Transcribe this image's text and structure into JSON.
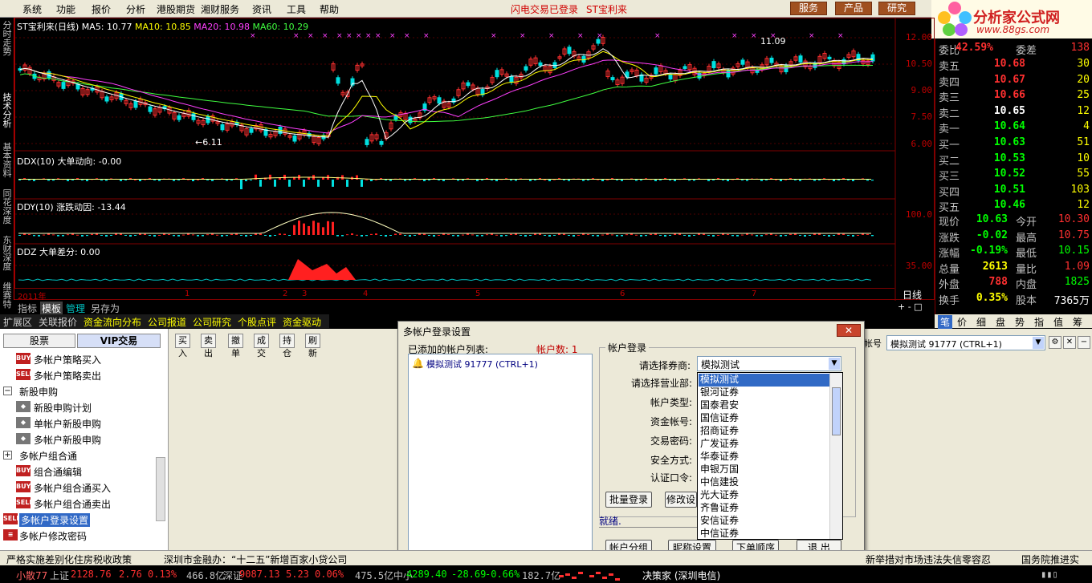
{
  "menu": {
    "items": [
      "系统",
      "功能",
      "报价",
      "分析",
      "港股期货",
      "湘财服务",
      "资讯",
      "工具",
      "帮助"
    ],
    "status": [
      "闪电交易已登录",
      "ST宝利来"
    ],
    "buttons": [
      "服务",
      "产品",
      "研究"
    ]
  },
  "logo": {
    "text": "分析家公式网",
    "url": "www.88gs.com"
  },
  "vtabs": [
    "分时走势",
    "技术分析",
    "基本资料",
    "同花深度",
    "东财深度",
    "维赛特"
  ],
  "chart": {
    "title": "ST宝利来(日线)",
    "ma5": "MA5: 10.77",
    "ma10": "MA10: 10.85",
    "ma20": "MA20: 10.98",
    "ma60": "MA60: 10.29",
    "price_axis": [
      "12.00",
      "10.50",
      "9.00",
      "7.50",
      "6.00"
    ],
    "low_label": "←6.11",
    "high_label": "11.09",
    "ddx_title": "DDX(10) 大单动向: -0.00",
    "ddy_title": "DDY(10) 涨跌动因: -13.44",
    "ddy_axis": "100.0",
    "ddz_title": "DDZ 大单差分: 0.00",
    "ddz_axis": "35.00",
    "x_ticks": [
      "2011年",
      "1",
      "2",
      "3",
      "4",
      "5",
      "6",
      "7"
    ],
    "period": "日线"
  },
  "chart_tabs": [
    "指标",
    "模板",
    "管理",
    "另存为"
  ],
  "ext_tabs": [
    "扩展区",
    "关联报价",
    "资金流向分布",
    "公司报道",
    "公司研究",
    "个股点评",
    "资金驱动"
  ],
  "quote": {
    "ratio": {
      "label": "委比",
      "value": "42.59%",
      "label2": "委差",
      "value2": "138"
    },
    "asks": [
      {
        "label": "卖五",
        "price": "10.68",
        "vol": "30"
      },
      {
        "label": "卖四",
        "price": "10.67",
        "vol": "20"
      },
      {
        "label": "卖三",
        "price": "10.66",
        "vol": "25"
      },
      {
        "label": "卖二",
        "price": "10.65",
        "vol": "12"
      },
      {
        "label": "卖一",
        "price": "10.64",
        "vol": "4"
      }
    ],
    "bids": [
      {
        "label": "买一",
        "price": "10.63",
        "vol": "51"
      },
      {
        "label": "买二",
        "price": "10.53",
        "vol": "10"
      },
      {
        "label": "买三",
        "price": "10.52",
        "vol": "55"
      },
      {
        "label": "买四",
        "price": "10.51",
        "vol": "103"
      },
      {
        "label": "买五",
        "price": "10.46",
        "vol": "12"
      }
    ],
    "stats": [
      {
        "l1": "现价",
        "v1": "10.63",
        "l2": "今开",
        "v2": "10.30"
      },
      {
        "l1": "涨跌",
        "v1": "-0.02",
        "l2": "最高",
        "v2": "10.75"
      },
      {
        "l1": "涨幅",
        "v1": "-0.19%",
        "l2": "最低",
        "v2": "10.15"
      },
      {
        "l1": "总量",
        "v1": "2613",
        "l2": "量比",
        "v2": "1.09"
      },
      {
        "l1": "外盘",
        "v1": "788",
        "l2": "内盘",
        "v2": "1825"
      },
      {
        "l1": "换手",
        "v1": "0.35%",
        "l2": "股本",
        "v2": "7365万"
      }
    ],
    "tabs": [
      "笔",
      "价",
      "细",
      "盘",
      "势",
      "指",
      "值",
      "筹"
    ]
  },
  "tree": {
    "tabs": [
      "股票",
      "VIP交易"
    ],
    "items": [
      "多帐户策略买入",
      "多帐户策略卖出",
      "新股申购",
      "新股申购计划",
      "单帐户新股申购",
      "多帐户新股申购",
      "多帐户组合通",
      "组合通编辑",
      "多帐户组合通买入",
      "多帐户组合通卖出",
      "多帐户登录设置",
      "多帐户修改密码"
    ],
    "icons": [
      "BUY",
      "SELL",
      "BUY",
      "SELL"
    ]
  },
  "toolbar": [
    "买入",
    "卖出",
    "撤单",
    "成交",
    "持仓",
    "刷新"
  ],
  "account_select": {
    "value": "模拟测试 91777 (CTRL+1)",
    "tail_label": "帐号"
  },
  "dialog": {
    "title": "多帐户登录设置",
    "list_label": "已添加的帐户列表:",
    "count_label": "帐户数: 1",
    "account_item": "模拟测试 91777 (CTRL+1)",
    "group_title": "帐户登录",
    "fields": [
      "请选择券商:",
      "请选择营业部:",
      "帐户类型:",
      "资金帐号:",
      "交易密码:",
      "安全方式:",
      "认证口令:"
    ],
    "broker_value": "模拟测试",
    "brokers": [
      "模拟测试",
      "银河证券",
      "国泰君安",
      "国信证券",
      "招商证券",
      "广发证券",
      "华泰证券",
      "申银万国",
      "中信建投",
      "光大证券",
      "齐鲁证券",
      "安信证券",
      "中信证券"
    ],
    "btn_batch": "批量登录",
    "btn_modify": "修改设",
    "status": "就绪.",
    "btn_group": "帐户分组",
    "btn_nick": "昵称设置",
    "btn_order": "下单顺序",
    "btn_exit": "退 出"
  },
  "news": [
    "严格实施差别化住房税收政策",
    "深圳市金融办：“十二五”新增百家小贷公司",
    "新举措",
    "对市场违法失信零容忍",
    "国务院推进实"
  ],
  "index_bar": {
    "name": "小散77",
    "sh_label": "上证",
    "sh_value": "2128.76",
    "sh_change": "2.76",
    "sh_pct": "0.13%",
    "sh_amount": "466.8亿",
    "sz_label": "深证",
    "sz_value": "9087.13",
    "sz_change": "5.23",
    "sz_pct": "0.06%",
    "sz_amount": "475.5亿",
    "zx_label": "中小",
    "zx_value": "4289.40",
    "zx_change": "-28.69",
    "zx_pct": "-0.66%",
    "zx_amount": "182.7亿",
    "source": "决策家 (深圳电信)"
  }
}
